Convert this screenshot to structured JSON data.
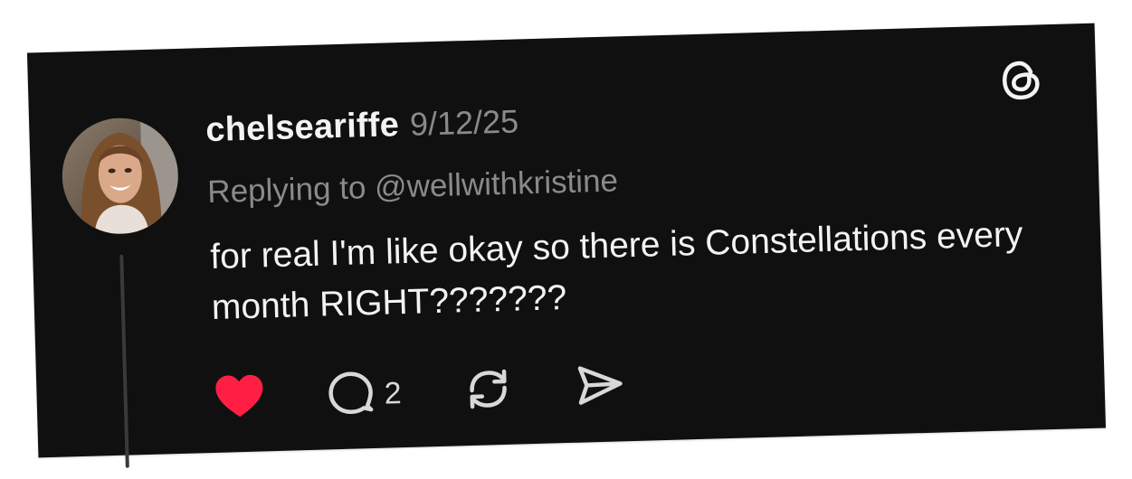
{
  "post": {
    "username": "chelseariffe",
    "timestamp": "9/12/25",
    "replying_to": "Replying to @wellwithkristine",
    "text": "for real I'm like okay so there is Constellations every month RIGHT???????",
    "reply_count": "2",
    "liked": true
  },
  "icons": {
    "logo": "threads-logo-icon",
    "like": "heart-icon",
    "reply": "comment-bubble-icon",
    "repost": "repost-icon",
    "share": "send-icon"
  },
  "colors": {
    "card_background": "#101010",
    "text_primary": "#f3f3f3",
    "text_secondary": "#8a8a8a",
    "like_red": "#ff1f44"
  }
}
